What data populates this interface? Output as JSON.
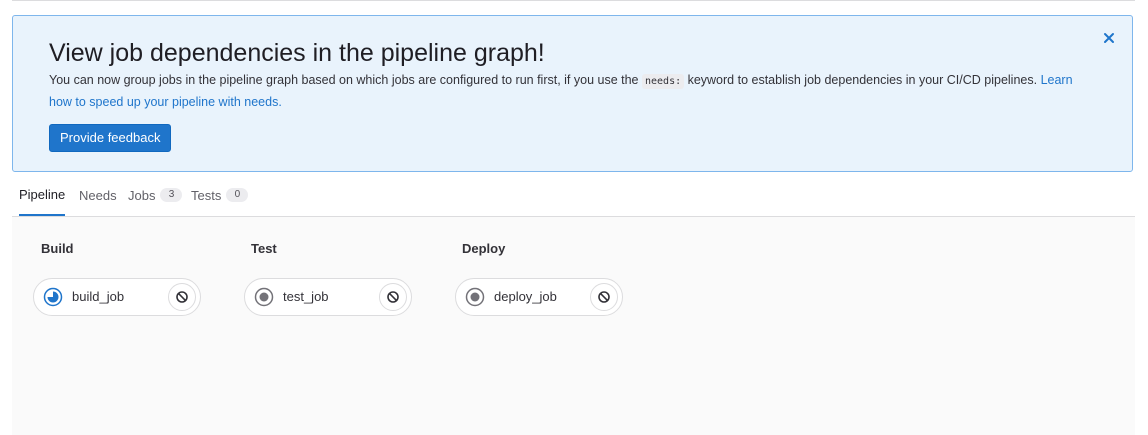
{
  "banner": {
    "title": "View job dependencies in the pipeline graph!",
    "body_before_code": "You can now group jobs in the pipeline graph based on which jobs are configured to run first, if you use the ",
    "code": "needs:",
    "body_after_code": " keyword to establish job dependencies in your CI/CD pipelines. ",
    "link_text": "Learn how to speed up your pipeline with needs.",
    "feedback_button": "Provide feedback",
    "close_icon": "close-icon",
    "colors": {
      "background": "#e9f3fc",
      "border": "#7eb6ec",
      "link": "#1f75cb",
      "button": "#1f75cb"
    }
  },
  "tabs": [
    {
      "label": "Pipeline",
      "active": true
    },
    {
      "label": "Needs"
    },
    {
      "label": "Jobs",
      "count": "3"
    },
    {
      "label": "Tests",
      "count": "0"
    }
  ],
  "stages": [
    {
      "name": "Build",
      "jobs": [
        {
          "name": "build_job",
          "status": "running",
          "status_icon": "status-running-icon",
          "action_icon": "cancel-icon"
        }
      ]
    },
    {
      "name": "Test",
      "jobs": [
        {
          "name": "test_job",
          "status": "created",
          "status_icon": "status-created-icon",
          "action_icon": "cancel-icon"
        }
      ]
    },
    {
      "name": "Deploy",
      "jobs": [
        {
          "name": "deploy_job",
          "status": "created",
          "status_icon": "status-created-icon",
          "action_icon": "cancel-icon"
        }
      ]
    }
  ],
  "status_colors": {
    "running": "#1f75cb",
    "created": "#737278"
  }
}
